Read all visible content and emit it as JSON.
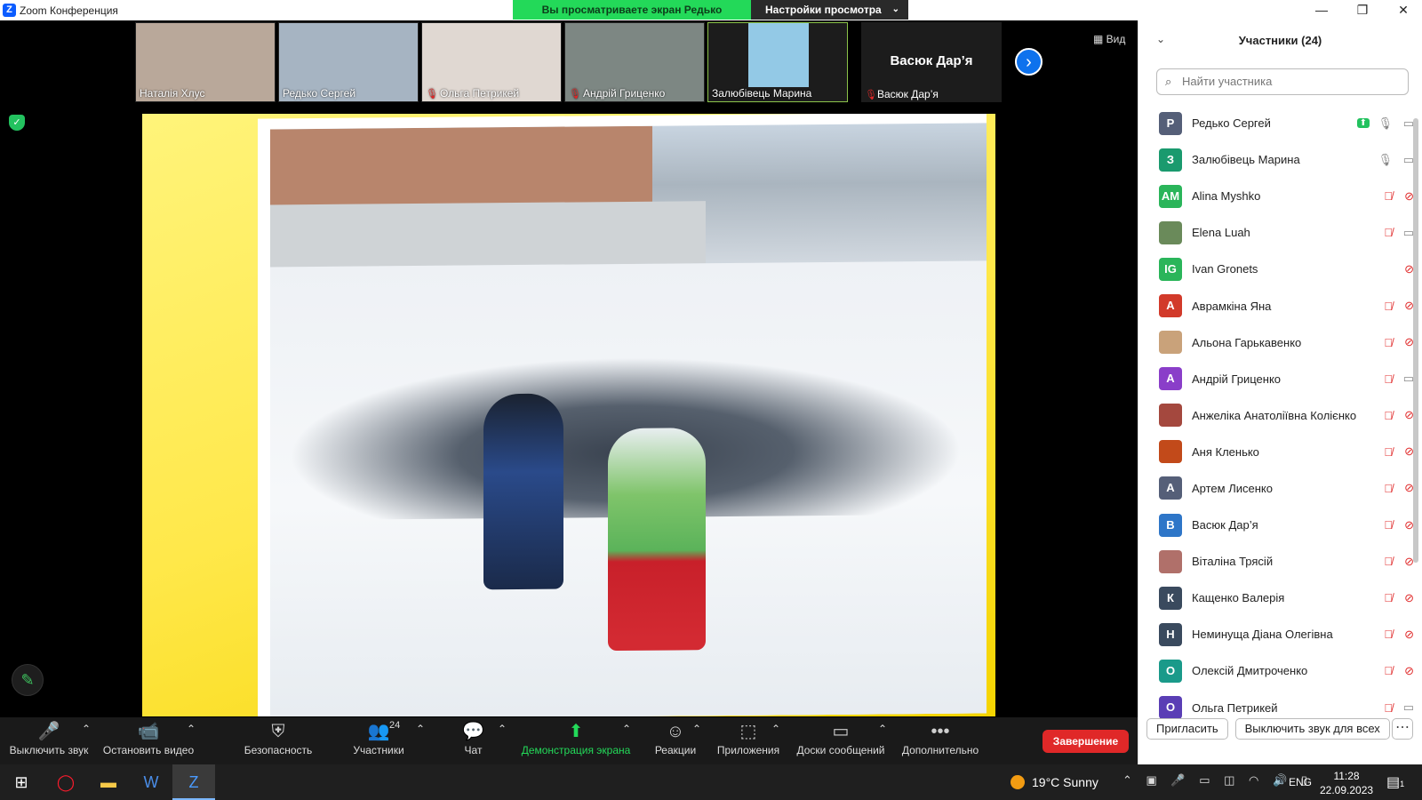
{
  "titlebar": {
    "title": "Zoom Конференция",
    "logo": "Z"
  },
  "share_banner": {
    "viewing": "Вы просматриваете экран Редько Сергей",
    "view_settings": "Настройки просмотра"
  },
  "thumbnails": [
    {
      "name": "Наталія Хлус",
      "muted": false,
      "bg": "#b9a89a"
    },
    {
      "name": "Редько Сергей",
      "muted": false,
      "bg": "#9aa7b5"
    },
    {
      "name": "Ольга Петрикей",
      "muted": true,
      "bg": "#d8cfc8"
    },
    {
      "name": "Андрій Гриценко",
      "muted": true,
      "bg": "#808a86"
    },
    {
      "name": "Залюбівець Марина",
      "muted": false,
      "bg": "#93c9e6"
    }
  ],
  "name_tile": {
    "big_name": "Васюк Дар’я",
    "name": "Васюк Дар’я"
  },
  "view_label": "Вид",
  "toolbar": {
    "mute": "Выключить звук",
    "video": "Остановить видео",
    "security": "Безопасность",
    "participants": "Участники",
    "participants_count": "24",
    "chat": "Чат",
    "share": "Демонстрация экрана",
    "reactions": "Реакции",
    "apps": "Приложения",
    "whiteboards": "Доски сообщений",
    "more": "Дополнительно",
    "end": "Завершение"
  },
  "panel": {
    "title": "Участники (24)",
    "search_placeholder": "Найти участника",
    "invite": "Пригласить",
    "mute_all": "Выключить звук для всех",
    "participants": [
      {
        "initials": "Р",
        "name": "Редько Сергей",
        "color": "#555f78",
        "sharing": true,
        "mic": "on",
        "cam": "on"
      },
      {
        "initials": "З",
        "name": "Залюбівець Марина",
        "color": "#1a9a6e",
        "sharing": false,
        "mic": "on",
        "cam": "on"
      },
      {
        "initials": "AM",
        "name": "Alina Myshko",
        "color": "#2ab55a",
        "sharing": false,
        "mic": "off",
        "cam": "off"
      },
      {
        "initials": "",
        "name": "Elena Luah",
        "color": "#6a8a5a",
        "sharing": false,
        "mic": "off",
        "cam": "on"
      },
      {
        "initials": "IG",
        "name": "Ivan Gronets",
        "color": "#2ab55a",
        "sharing": false,
        "mic": "none",
        "cam": "off"
      },
      {
        "initials": "А",
        "name": "Аврамкіна Яна",
        "color": "#d23a2a",
        "sharing": false,
        "mic": "off",
        "cam": "off"
      },
      {
        "initials": "",
        "name": "Альона Гарькавенко",
        "color": "#c9a27a",
        "sharing": false,
        "mic": "off",
        "cam": "off"
      },
      {
        "initials": "А",
        "name": "Андрій Гриценко",
        "color": "#8a3ec9",
        "sharing": false,
        "mic": "off",
        "cam": "on"
      },
      {
        "initials": "",
        "name": "Анжеліка Анатоліївна Колієнко",
        "color": "#a4483e",
        "sharing": false,
        "mic": "off",
        "cam": "off"
      },
      {
        "initials": "",
        "name": "Аня Кленько",
        "color": "#c24a1a",
        "sharing": false,
        "mic": "off",
        "cam": "off"
      },
      {
        "initials": "А",
        "name": "Артем Лисенко",
        "color": "#555f78",
        "sharing": false,
        "mic": "off",
        "cam": "off"
      },
      {
        "initials": "В",
        "name": "Васюк Дар’я",
        "color": "#2e76c8",
        "sharing": false,
        "mic": "off",
        "cam": "off"
      },
      {
        "initials": "",
        "name": "Віталіна Трясій",
        "color": "#b0706a",
        "sharing": false,
        "mic": "off",
        "cam": "off"
      },
      {
        "initials": "К",
        "name": "Кащенко Валерія",
        "color": "#3a4a5e",
        "sharing": false,
        "mic": "off",
        "cam": "off"
      },
      {
        "initials": "Н",
        "name": "Неминуща Діана Олегівна",
        "color": "#3a4a5e",
        "sharing": false,
        "mic": "off",
        "cam": "off"
      },
      {
        "initials": "О",
        "name": "Олексій Дмитроченко",
        "color": "#1a9a8a",
        "sharing": false,
        "mic": "off",
        "cam": "off"
      },
      {
        "initials": "О",
        "name": "Ольга Петрикей",
        "color": "#5a3eb5",
        "sharing": false,
        "mic": "off",
        "cam": "on"
      }
    ]
  },
  "taskbar": {
    "temperature": "19°C",
    "weather": "Sunny",
    "lang": "ENG",
    "time": "11:28",
    "date": "22.09.2023",
    "notif_count": "1"
  }
}
